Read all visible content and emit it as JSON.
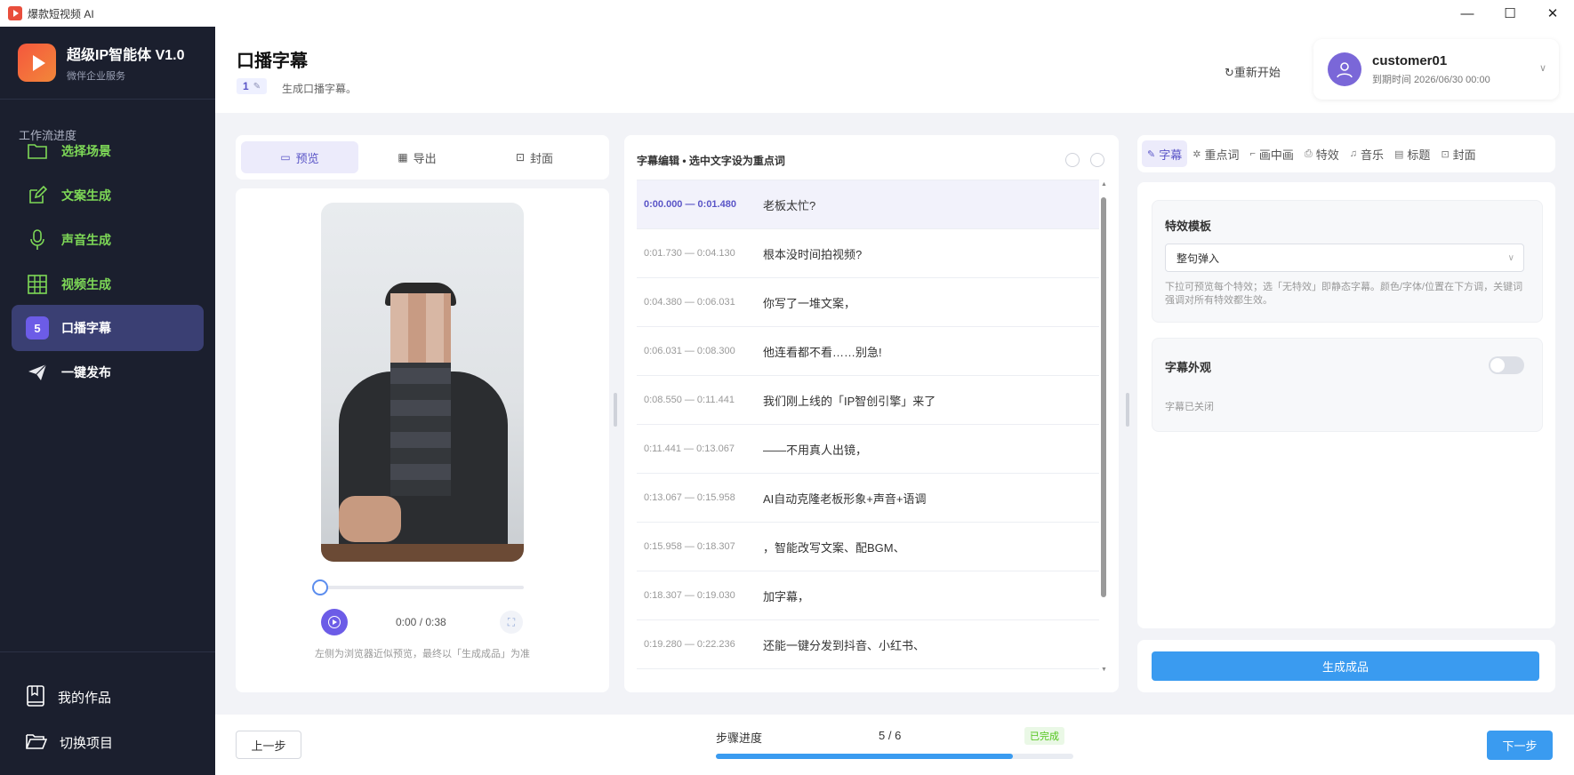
{
  "window": {
    "title": "爆款短视频 AI",
    "minimize": "—",
    "maximize": "☐",
    "close": "✕"
  },
  "brand": {
    "name": "超级IP智能体 V1.0",
    "subtitle": "微伴企业服务"
  },
  "sidebar": {
    "section_title": "工作流进度",
    "items": [
      {
        "label": "选择场景",
        "icon": "folder-icon",
        "state": "done"
      },
      {
        "label": "文案生成",
        "icon": "edit-icon",
        "state": "done"
      },
      {
        "label": "声音生成",
        "icon": "microphone-icon",
        "state": "done"
      },
      {
        "label": "视频生成",
        "icon": "grid-icon",
        "state": "done"
      },
      {
        "label": "口播字幕",
        "step": "5",
        "state": "active"
      },
      {
        "label": "一键发布",
        "icon": "send-icon",
        "state": "todo"
      }
    ],
    "bottom": [
      {
        "label": "我的作品",
        "icon": "book-icon"
      },
      {
        "label": "切换项目",
        "icon": "folder-open-icon"
      }
    ]
  },
  "header": {
    "title": "口播字幕",
    "badge": "1",
    "description": "生成口播字幕。",
    "restart": "重新开始",
    "user": {
      "name": "customer01",
      "expiry": "到期时间  2026/06/30 00:00"
    }
  },
  "preview_tabs": [
    {
      "label": "预览",
      "icon": "video-icon"
    },
    {
      "label": "导出",
      "icon": "film-icon"
    },
    {
      "label": "封面",
      "icon": "image-icon"
    }
  ],
  "player": {
    "time": "0:00 / 0:38",
    "progress": 0,
    "note": "左侧为浏览器近似预览，最终以「生成成品」为准"
  },
  "editor": {
    "title": "字幕编辑 • 选中文字设为重点词",
    "subtitles": [
      {
        "time": "0:00.000 — 0:01.480",
        "text": "老板太忙?"
      },
      {
        "time": "0:01.730 — 0:04.130",
        "text": "根本没时间拍视频?"
      },
      {
        "time": "0:04.380 — 0:06.031",
        "text": "你写了一堆文案，"
      },
      {
        "time": "0:06.031 — 0:08.300",
        "text": "他连看都不看……别急!"
      },
      {
        "time": "0:08.550 — 0:11.441",
        "text": "我们刚上线的「IP智创引擎」来了"
      },
      {
        "time": "0:11.441 — 0:13.067",
        "text": "——不用真人出镜，"
      },
      {
        "time": "0:13.067 — 0:15.958",
        "text": "AI自动克隆老板形象+声音+语调"
      },
      {
        "time": "0:15.958 — 0:18.307",
        "text": "，智能改写文案、配BGM、"
      },
      {
        "time": "0:18.307 — 0:19.030",
        "text": "加字幕，"
      },
      {
        "time": "0:19.280 — 0:22.236",
        "text": "还能一键分发到抖音、小红书、"
      }
    ]
  },
  "right_tabs": [
    {
      "label": "字幕",
      "icon": "pen-icon"
    },
    {
      "label": "重点词",
      "icon": "sparkle-icon"
    },
    {
      "label": "画中画",
      "icon": "crop-icon"
    },
    {
      "label": "特效",
      "icon": "magic-icon"
    },
    {
      "label": "音乐",
      "icon": "headphones-icon"
    },
    {
      "label": "标题",
      "icon": "document-icon"
    },
    {
      "label": "封面",
      "icon": "image-icon"
    }
  ],
  "effects": {
    "title": "特效模板",
    "selected": "整句弹入",
    "hint": "下拉可预览每个特效；选「无特效」即静态字幕。颜色/字体/位置在下方调，关键词强调对所有特效都生效。"
  },
  "appearance": {
    "title": "字幕外观",
    "status": "字幕已关闭",
    "enabled": false
  },
  "generate_button": "生成成品",
  "footer": {
    "prev": "上一步",
    "progress_label": "步骤进度",
    "progress_count": "5 / 6",
    "status": "已完成",
    "progress": 0.83,
    "next": "下一步"
  }
}
